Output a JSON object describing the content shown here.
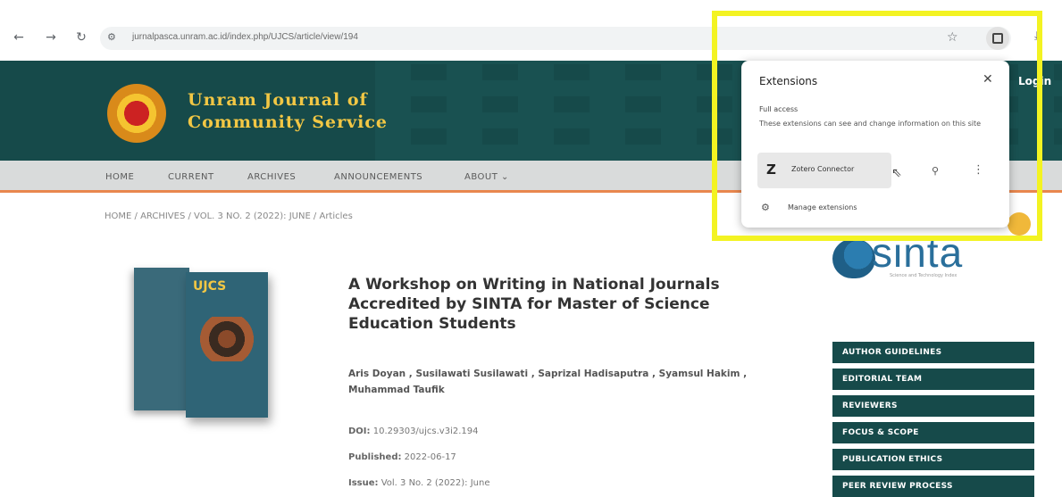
{
  "browser": {
    "url": "jurnalpasca.unram.ac.id/index.php/UJCS/article/view/194",
    "back_glyph": "←",
    "forward_glyph": "→",
    "reload_glyph": "↻"
  },
  "site": {
    "journal_name_line1": "Unram Journal of",
    "journal_name_line2": "Community Service",
    "login": "Login",
    "header_color": "#164a4a",
    "accent": "#e9874e"
  },
  "menu": {
    "items": [
      "HOME",
      "CURRENT",
      "ARCHIVES",
      "ANNOUNCEMENTS",
      "ABOUT ⌄"
    ]
  },
  "breadcrumb": "HOME / ARCHIVES / VOL. 3 NO. 2 (2022): JUNE / Articles",
  "cover": {
    "title": "UJCS"
  },
  "article": {
    "title": "A Workshop on Writing in National Journals Accredited by SINTA for Master of Science Education Students",
    "authors": "Aris Doyan , Susilawati Susilawati , Saprizal Hadisaputra , Syamsul Hakim , Muhammad Taufik",
    "doi_label": "DOI:",
    "doi_value": "10.29303/ujcs.v3i2.194",
    "published_label": "Published:",
    "published_value": "2022-06-17",
    "issue_label": "Issue:",
    "issue_value": "Vol. 3 No. 2 (2022): June"
  },
  "sinta": {
    "text": "sinta",
    "subtitle": "Science and Technology Index"
  },
  "sidebar": {
    "buttons": [
      "AUTHOR GUIDELINES",
      "EDITORIAL TEAM",
      "REVIEWERS",
      "FOCUS & SCOPE",
      "PUBLICATION ETHICS",
      "PEER REVIEW PROCESS"
    ]
  },
  "extensions_popup": {
    "title": "Extensions",
    "section": "Full access",
    "description": "These extensions can see and change information on this site",
    "extension_name": "Zotero Connector",
    "extension_logo": "Z",
    "manage_label": "Manage extensions",
    "highlight_color": "#f3f322"
  }
}
